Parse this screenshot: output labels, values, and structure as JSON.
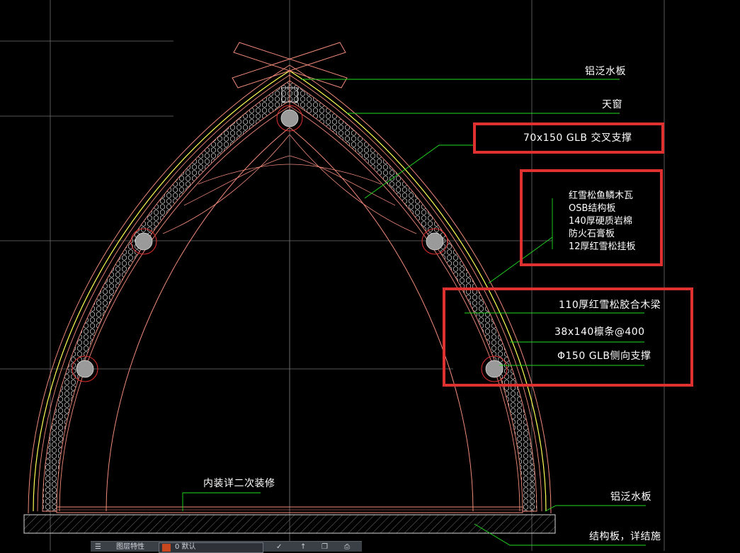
{
  "labels": {
    "flashing_top": "铝泛水板",
    "skylight": "天窗",
    "cross_brace": "70x150 GLB  交叉支撑",
    "layers": [
      "红雪松鱼鳞木瓦",
      "OSB结构板",
      "140厚硬质岩棉",
      "防火石膏板",
      "12厚红雪松挂板"
    ],
    "glulam_beam": "110厚红雪松胶合木梁",
    "purlin": "38x140檩条@400",
    "side_brace": "Φ150 GLB侧向支撑",
    "interior": "内装详二次装修",
    "flashing_bottom": "铝泛水板",
    "structure_board": "结构板，详结施"
  },
  "toolbar": {
    "items": [
      "图层特性",
      "0 默认"
    ]
  },
  "colors": {
    "background": "#000000",
    "arch": "#f08a7a",
    "leader": "#22dd22",
    "flashing": "#ffff55",
    "callout": "#e03131",
    "text": "#ffffff",
    "grid": "#777777"
  }
}
